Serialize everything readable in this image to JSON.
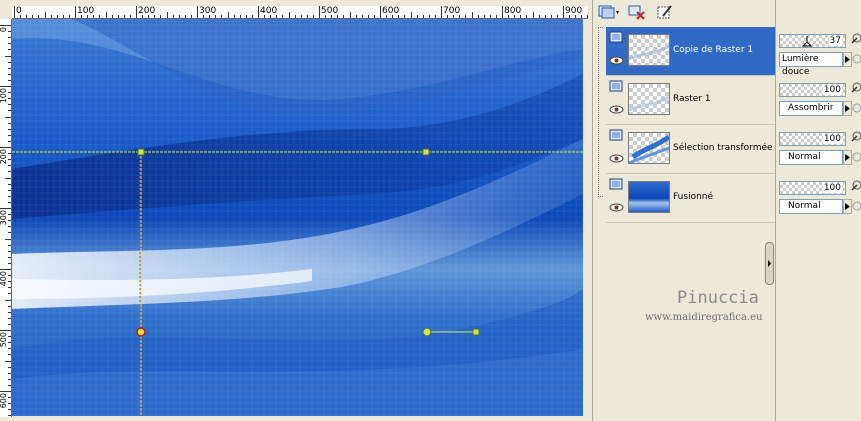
{
  "ruler": {
    "top_labels": [
      "0",
      "100",
      "200",
      "300",
      "400",
      "500",
      "600",
      "700",
      "800",
      "900"
    ],
    "left_labels": [
      "0",
      "100",
      "200",
      "300",
      "400",
      "500",
      "600"
    ]
  },
  "toolbar": {
    "new_layer_icon": "new-layer-icon",
    "delete_layer_icon": "delete-layer-icon",
    "edit_mask_icon": "edit-mask-icon"
  },
  "layers": [
    {
      "name": "Copie de Raster 1",
      "selected": true,
      "opacity": "37",
      "blend": "Lumière douce"
    },
    {
      "name": "Raster 1",
      "selected": false,
      "opacity": "100",
      "blend": "Assombrir"
    },
    {
      "name": "Sélection transformée",
      "selected": false,
      "opacity": "100",
      "blend": "Normal"
    },
    {
      "name": "Fusionné",
      "selected": false,
      "opacity": "100",
      "blend": "Normal"
    }
  ],
  "watermark": {
    "title": "Pinuccia",
    "url": "www.maidiregrafica.eu"
  },
  "colors": {
    "selected_row": "#316ac5",
    "panel_bg": "#ece9d8",
    "guide_line": "#c8e650",
    "canvas_blue": "#0b48b8"
  }
}
